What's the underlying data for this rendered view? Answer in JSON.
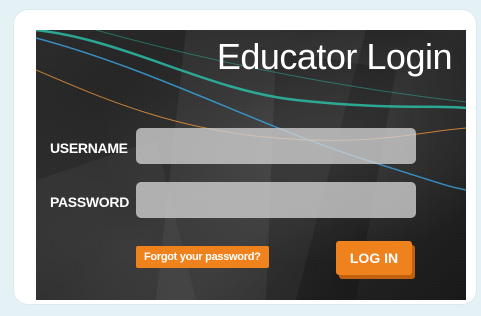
{
  "title": "Educator Login",
  "form": {
    "username_label": "USERNAME",
    "username_value": "",
    "password_label": "PASSWORD",
    "password_value": "",
    "forgot_label": "Forgot your password?",
    "login_label": "LOG IN"
  },
  "colors": {
    "page_background": "#e4f2f6",
    "card": "#ffffff",
    "accent_orange": "#f0821e",
    "line_teal": "#2bb5a0",
    "line_blue": "#3aa0d8",
    "line_orange": "#e0913a"
  }
}
